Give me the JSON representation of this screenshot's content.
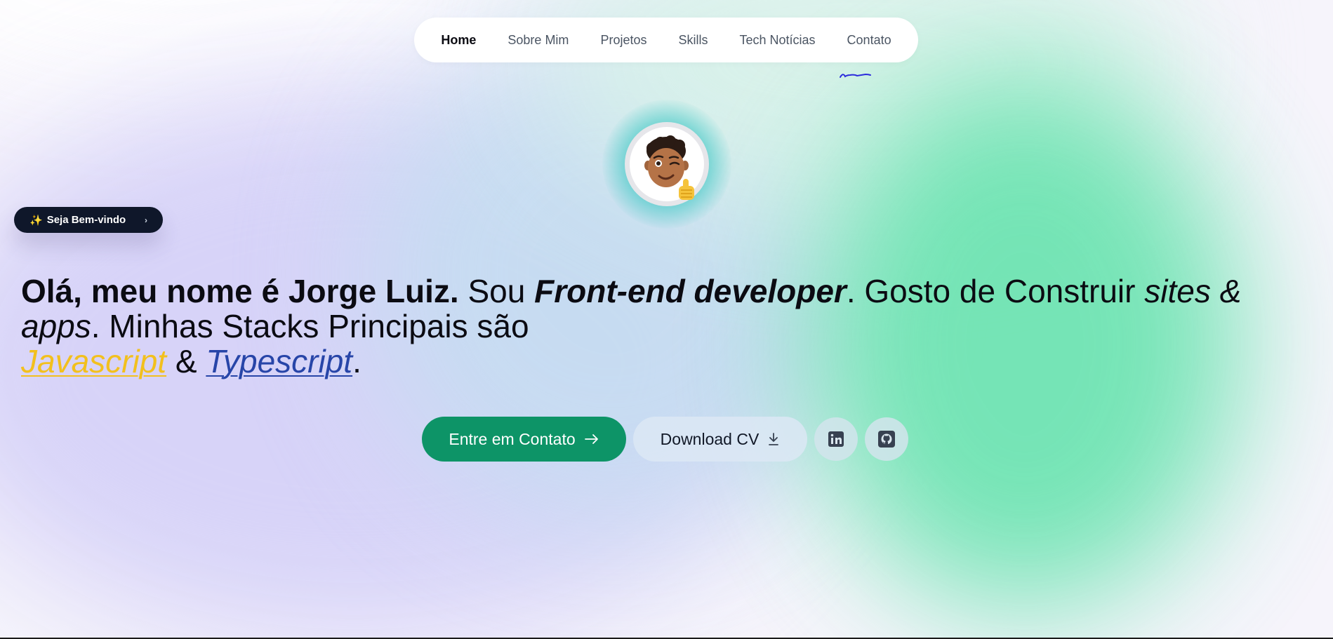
{
  "nav": {
    "items": [
      {
        "label": "Home",
        "active": true
      },
      {
        "label": "Sobre Mim"
      },
      {
        "label": "Projetos"
      },
      {
        "label": "Skills"
      },
      {
        "label": "Tech Notícias"
      },
      {
        "label": "Contato"
      }
    ]
  },
  "avatar": {
    "icon": "memoji-thumbs-up-icon"
  },
  "badge": {
    "label": "Seja Bem-vindo",
    "icon": "sparkles-icon",
    "chevron": "›"
  },
  "hero": {
    "part1_bold": "Olá, meu nome é Jorge Luiz.",
    "part2": " Sou ",
    "part3_bold_italic": "Front-end developer",
    "part4": ". Gosto de Construir ",
    "part5_italic": "sites & apps",
    "part6": ". Minhas Stacks Principais são",
    "js": "Javascript",
    "amp": " & ",
    "ts": "Typescript",
    "end": "."
  },
  "buttons": {
    "contact_label": "Entre em Contato",
    "cv_label": "Download CV",
    "linkedin_icon": "linkedin-icon",
    "github_icon": "github-icon"
  },
  "colors": {
    "primary_green": "#0d9467",
    "badge_bg": "#0f172a",
    "javascript": "#f2c01e",
    "typescript": "#2745a8",
    "scribble": "#2b2bdc"
  }
}
